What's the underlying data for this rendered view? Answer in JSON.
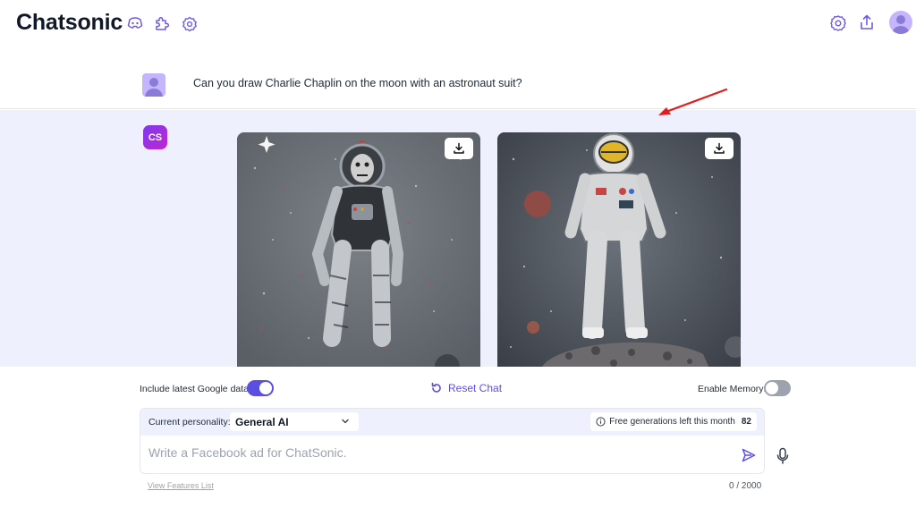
{
  "app": {
    "brand": "Chatsonic"
  },
  "header": {
    "left_icons": [
      "discord-icon",
      "puzzle-icon",
      "badge-settings-icon"
    ],
    "right_icons": [
      "settings-icon",
      "share-icon",
      "avatar"
    ]
  },
  "conversation": {
    "user_message": "Can you draw Charlie Chaplin on the moon with an astronaut suit?",
    "bot_logo": "CS",
    "images": [
      {
        "name": "astronaut-image-1",
        "download_icon": "download-icon"
      },
      {
        "name": "astronaut-image-2",
        "download_icon": "download-icon"
      }
    ]
  },
  "controls": {
    "google_label": "Include latest Google data:",
    "google_enabled": true,
    "reset_label": "Reset Chat",
    "memory_label": "Enable Memory:",
    "memory_enabled": false
  },
  "composer": {
    "personality_label": "Current personality:",
    "personality_value": "General AI",
    "free_gen_label": "Free generations left this month",
    "free_gen_count": "82",
    "placeholder": "Write a Facebook ad for ChatSonic.",
    "features_link": "View Features List",
    "char_count": "0 / 2000"
  },
  "colors": {
    "accent": "#5b4fe3",
    "bot_bg": "#eef0fd",
    "annotation_arrow": "#e11d1d"
  }
}
